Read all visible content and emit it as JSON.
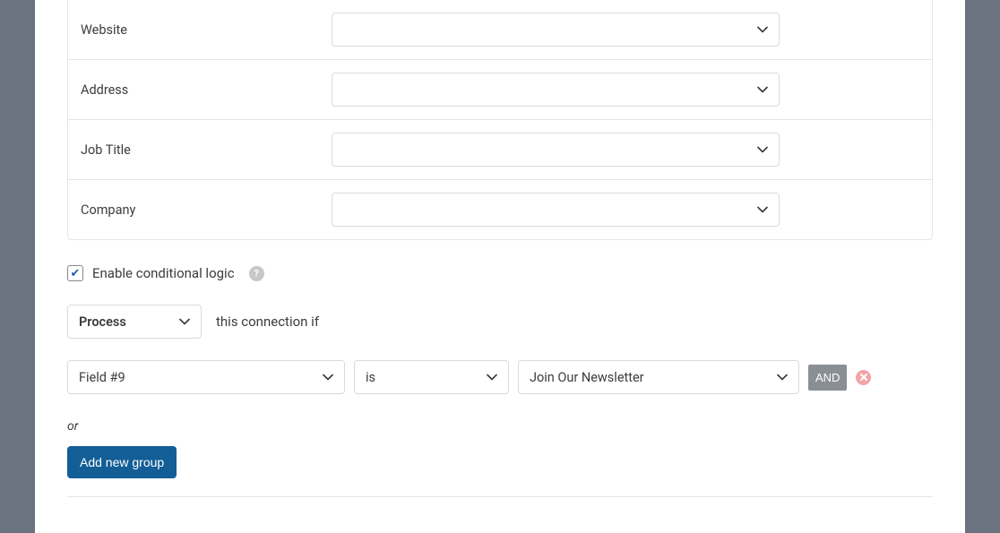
{
  "form_rows": [
    {
      "label": "Website"
    },
    {
      "label": "Address"
    },
    {
      "label": "Job Title"
    },
    {
      "label": "Company"
    }
  ],
  "conditional": {
    "checkbox_label": "Enable conditional logic",
    "checked": true,
    "process_label": "Process",
    "connection_text": "this connection if",
    "rule": {
      "field": "Field #9",
      "operator": "is",
      "value": "Join Our Newsletter",
      "and_label": "AND"
    },
    "or_label": "or",
    "add_group_label": "Add new group"
  }
}
